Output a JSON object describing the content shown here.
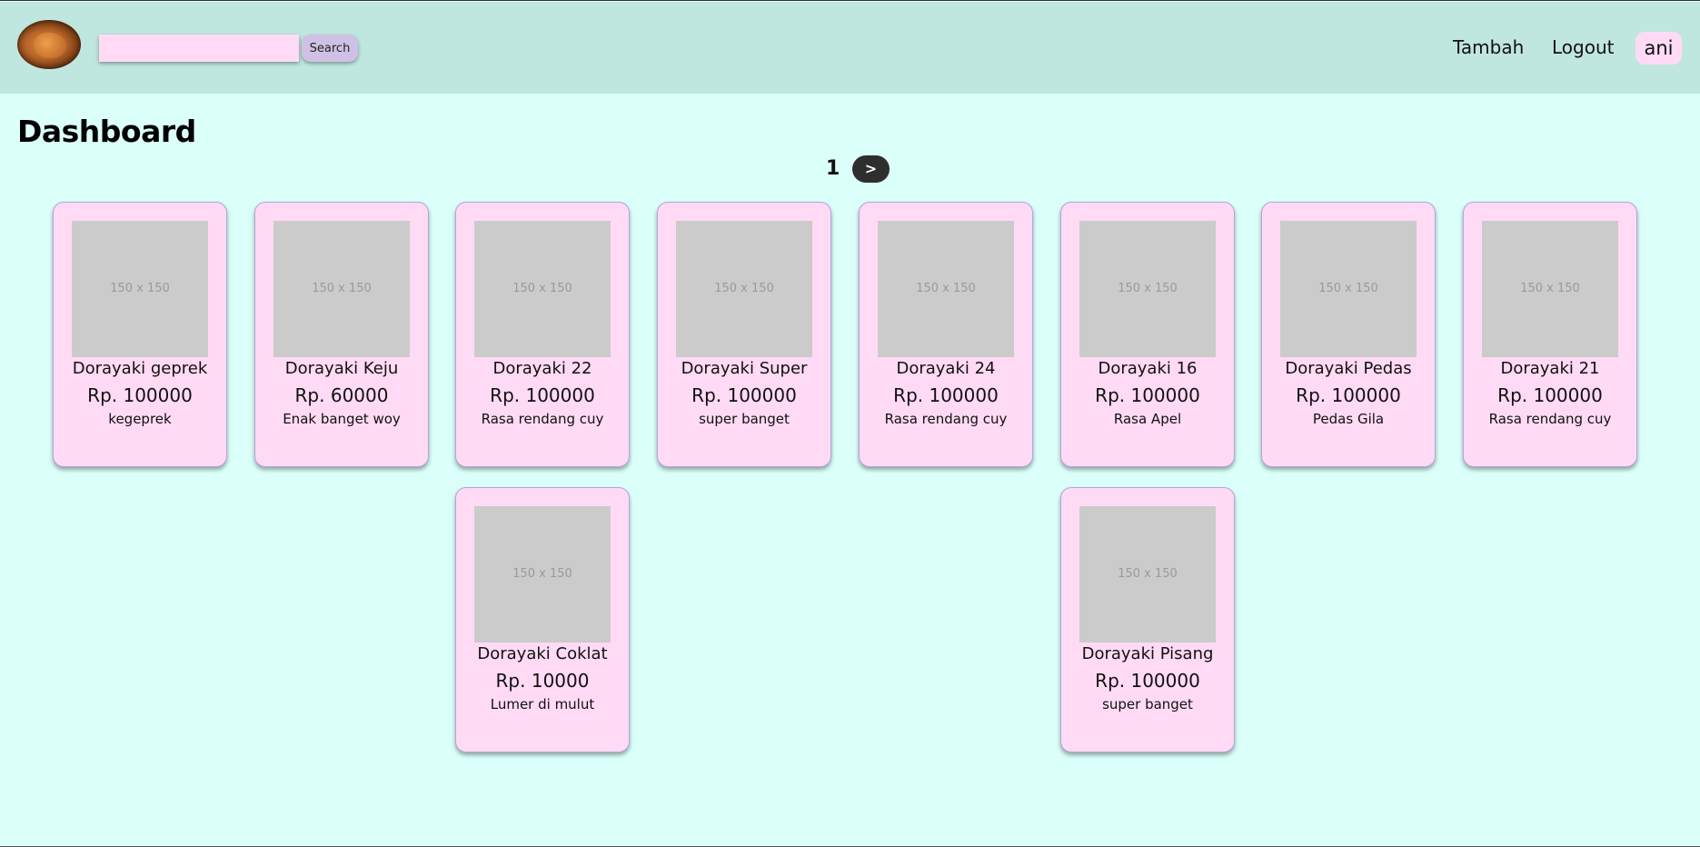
{
  "header": {
    "logo_alt": "dorayaki logo",
    "search": {
      "value": "",
      "placeholder": ""
    },
    "search_button_label": "Search",
    "nav": {
      "add_label": "Tambah",
      "logout_label": "Logout"
    },
    "user_name": "ani"
  },
  "main": {
    "title": "Dashboard",
    "pagination": {
      "current_page": "1",
      "next_label": ">"
    },
    "products": [
      {
        "image_label": "150 x 150",
        "name": "Dorayaki geprek",
        "price": "Rp. 100000",
        "description": "kegeprek"
      },
      {
        "image_label": "150 x 150",
        "name": "Dorayaki Keju",
        "price": "Rp. 60000",
        "description": "Enak banget woy"
      },
      {
        "image_label": "150 x 150",
        "name": "Dorayaki 22",
        "price": "Rp. 100000",
        "description": "Rasa rendang cuy"
      },
      {
        "image_label": "150 x 150",
        "name": "Dorayaki Super",
        "price": "Rp. 100000",
        "description": "super banget"
      },
      {
        "image_label": "150 x 150",
        "name": "Dorayaki 24",
        "price": "Rp. 100000",
        "description": "Rasa rendang cuy"
      },
      {
        "image_label": "150 x 150",
        "name": "Dorayaki 16",
        "price": "Rp. 100000",
        "description": "Rasa Apel"
      },
      {
        "image_label": "150 x 150",
        "name": "Dorayaki Pedas",
        "price": "Rp. 100000",
        "description": "Pedas Gila"
      },
      {
        "image_label": "150 x 150",
        "name": "Dorayaki 21",
        "price": "Rp. 100000",
        "description": "Rasa rendang cuy"
      },
      {
        "image_label": "150 x 150",
        "name": "Dorayaki Coklat",
        "price": "Rp. 10000",
        "description": "Lumer di mulut"
      },
      {
        "image_label": "150 x 150",
        "name": "Dorayaki Pisang",
        "price": "Rp. 100000",
        "description": "super banget"
      }
    ]
  },
  "colors": {
    "background": "#dbfff9",
    "navbar": "#c0e6e0",
    "card": "#ffdaf4",
    "card_border": "#b3a6dd",
    "search_button": "#cfc1e6",
    "placeholder_image": "#cbcbcb",
    "next_button": "#2e2e2e"
  }
}
